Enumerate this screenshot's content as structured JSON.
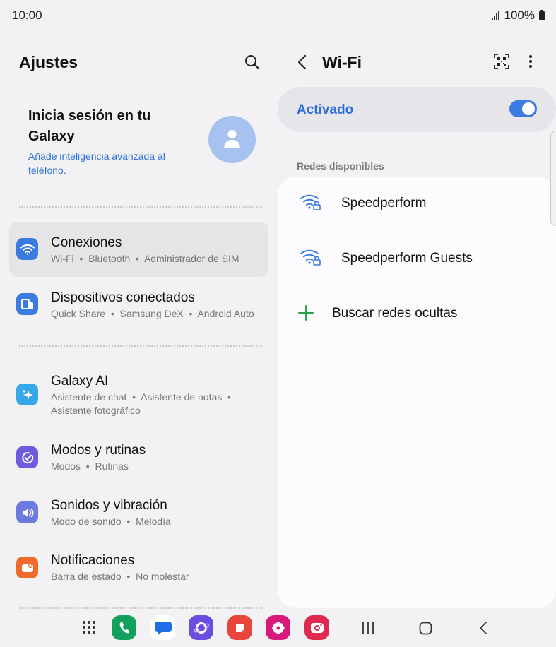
{
  "status": {
    "time": "10:00",
    "battery": "100%"
  },
  "settings": {
    "title": "Ajustes",
    "account": {
      "title": "Inicia sesión en tu Galaxy",
      "subtitle": "Añade inteligencia avanzada al teléfono."
    },
    "items": [
      {
        "label": "Conexiones",
        "sub": "Wi-Fi  •  Bluetooth  •  Administrador de SIM",
        "color": "#3b7ae0",
        "icon": "wifi-icon"
      },
      {
        "label": "Dispositivos conectados",
        "sub": "Quick Share  •  Samsung DeX  •  Android Auto",
        "color": "#3b7ae0",
        "icon": "devices-icon"
      },
      {
        "label": "Galaxy AI",
        "sub": "Asistente de chat  •  Asistente de notas  •",
        "sub2": "Asistente fotográfico",
        "color": "#36a7e8",
        "icon": "sparkle-icon"
      },
      {
        "label": "Modos y rutinas",
        "sub": "Modos  •  Rutinas",
        "color": "#6d5ce0",
        "icon": "check-circle-icon"
      },
      {
        "label": "Sonidos y vibración",
        "sub": "Modo de sonido  •  Melodía",
        "color": "#6d7ae0",
        "icon": "speaker-icon"
      },
      {
        "label": "Notificaciones",
        "sub": "Barra de estado  •  No molestar",
        "color": "#f06a2c",
        "icon": "notification-icon"
      }
    ]
  },
  "wifi": {
    "title": "Wi-Fi",
    "toggle_label": "Activado",
    "toggle_on": true,
    "section_label": "Redes disponibles",
    "networks": [
      {
        "name": "Speedperform"
      },
      {
        "name": "Speedperform Guests"
      }
    ],
    "add_label": "Buscar redes ocultas"
  },
  "taskbar": {
    "apps": [
      "phone-icon",
      "messages-icon",
      "internet-icon",
      "notes-icon",
      "gallery-icon",
      "camera-icon"
    ],
    "colors": {
      "phone": "#12a05c",
      "messages": "#1e6ee8",
      "internet": "#6b4de0",
      "notes": "#e8453c",
      "gallery": "#d81b7a",
      "camera": "#e0294f"
    }
  }
}
